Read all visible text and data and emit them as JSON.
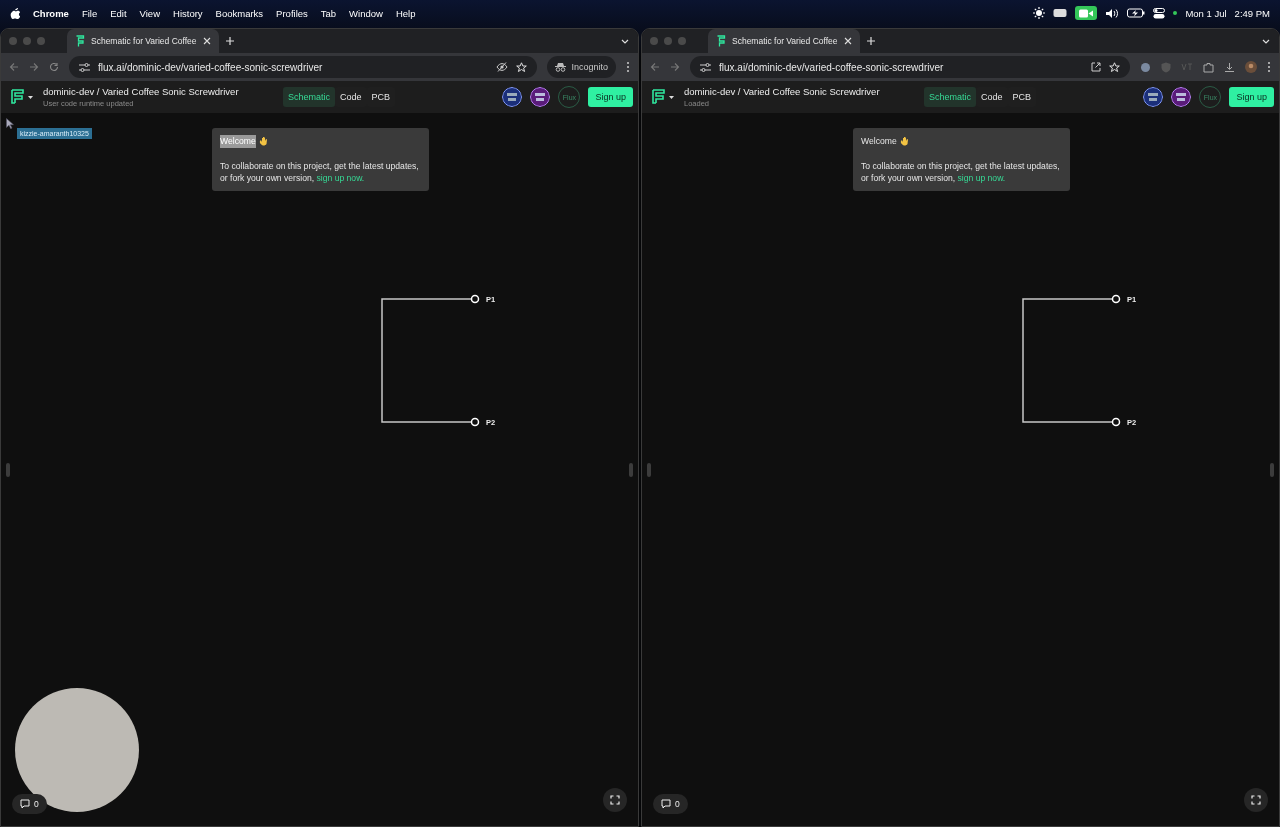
{
  "menubar": {
    "app": "Chrome",
    "menus": [
      "File",
      "Edit",
      "View",
      "History",
      "Bookmarks",
      "Profiles",
      "Tab",
      "Window",
      "Help"
    ],
    "date": "Mon 1 Jul",
    "time": "2:49 PM"
  },
  "windows": [
    {
      "tab_title": "Schematic for Varied Coffee",
      "url": "flux.ai/dominic-dev/varied-coffee-sonic-screwdriver",
      "incognito_label": "Incognito",
      "project": "dominic-dev / Varied Coffee Sonic Screwdriver",
      "status": "User code runtime updated",
      "view_tabs": [
        {
          "label": "Schematic",
          "selected": true
        },
        {
          "label": "Code",
          "selected": false
        },
        {
          "label": "PCB",
          "selected": false
        }
      ],
      "plan_badge": "Flux",
      "sign_up": "Sign up",
      "cursor_tag": "kizzie-amaranth10325",
      "welcome": {
        "title": "Welcome",
        "title_selected": true,
        "body": "To collaborate on this project, get the latest updates, or fork your own version,",
        "link": "sign up now."
      },
      "pins": [
        "P1",
        "P2"
      ],
      "comment_count": "0",
      "webcam": true
    },
    {
      "tab_title": "Schematic for Varied Coffee",
      "url": "flux.ai/dominic-dev/varied-coffee-sonic-screwdriver",
      "extension_icons": true,
      "project": "dominic-dev / Varied Coffee Sonic Screwdriver",
      "status": "Loaded",
      "view_tabs": [
        {
          "label": "Schematic",
          "selected": true
        },
        {
          "label": "Code",
          "selected": false
        },
        {
          "label": "PCB",
          "selected": false
        }
      ],
      "plan_badge": "Flux",
      "sign_up": "Sign up",
      "welcome": {
        "title": "Welcome",
        "title_selected": false,
        "body": "To collaborate on this project, get the latest updates, or fork your own version,",
        "link": "sign up now."
      },
      "pins": [
        "P1",
        "P2"
      ],
      "comment_count": "0",
      "webcam": false
    }
  ]
}
